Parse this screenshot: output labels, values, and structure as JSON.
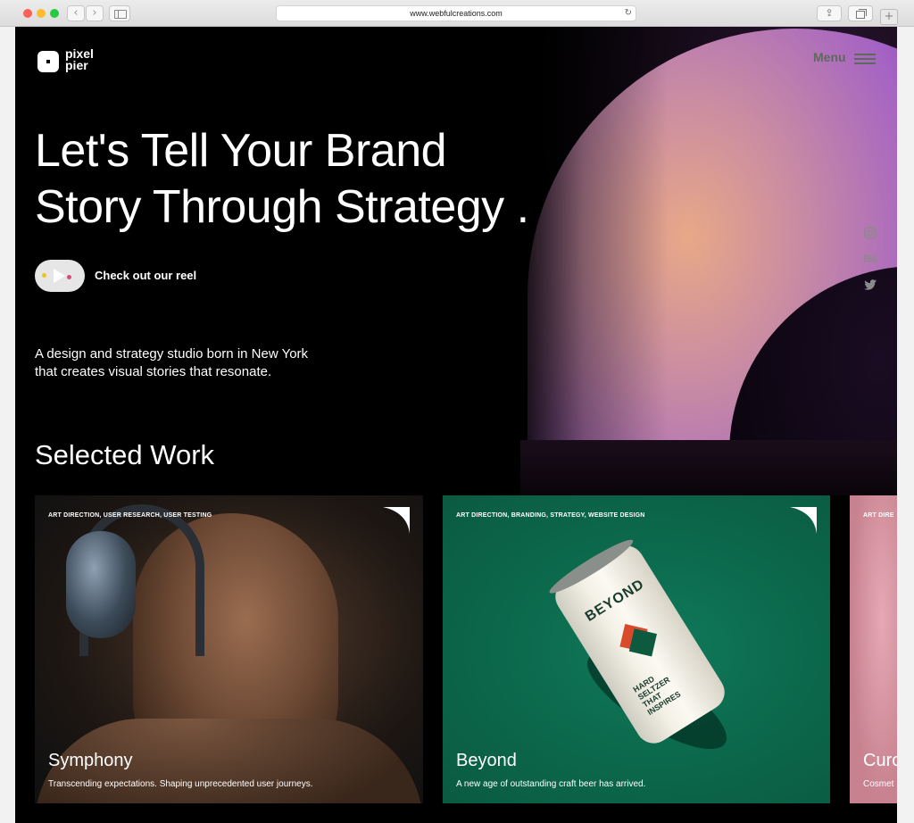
{
  "browser": {
    "url": "www.webfulcreations.com"
  },
  "logo": {
    "text": "pixel\npier"
  },
  "nav": {
    "menu_label": "Menu"
  },
  "hero": {
    "title_line1": "Let's Tell Your Brand",
    "title_line2": "Story Through Strategy .",
    "reel_label": "Check out our reel",
    "desc_line1": "A design and strategy studio born in New York",
    "desc_line2": "that creates visual stories that resonate."
  },
  "social": {
    "behance": "Bē"
  },
  "work": {
    "section_title": "Selected Work",
    "cards": [
      {
        "tags": "ART DIRECTION, USER RESEARCH, USER TESTING",
        "title": "Symphony",
        "desc": "Transcending expectations. Shaping unprecedented user journeys."
      },
      {
        "tags": "ART DIRECTION, BRANDING, STRATEGY, WEBSITE DESIGN",
        "title": "Beyond",
        "desc": "A new age of outstanding craft beer has arrived.",
        "can_brand": "BEYOND",
        "can_text": "HARD\nSELTZER\nTHAT\nINSPIRES"
      },
      {
        "tags": "ART DIRE",
        "title": "Curo",
        "desc": "Cosmet"
      }
    ]
  },
  "colors": {
    "page_bg": "#000000",
    "beyond_green": "#0c6a4d",
    "menu_text": "#5c6a5c"
  }
}
